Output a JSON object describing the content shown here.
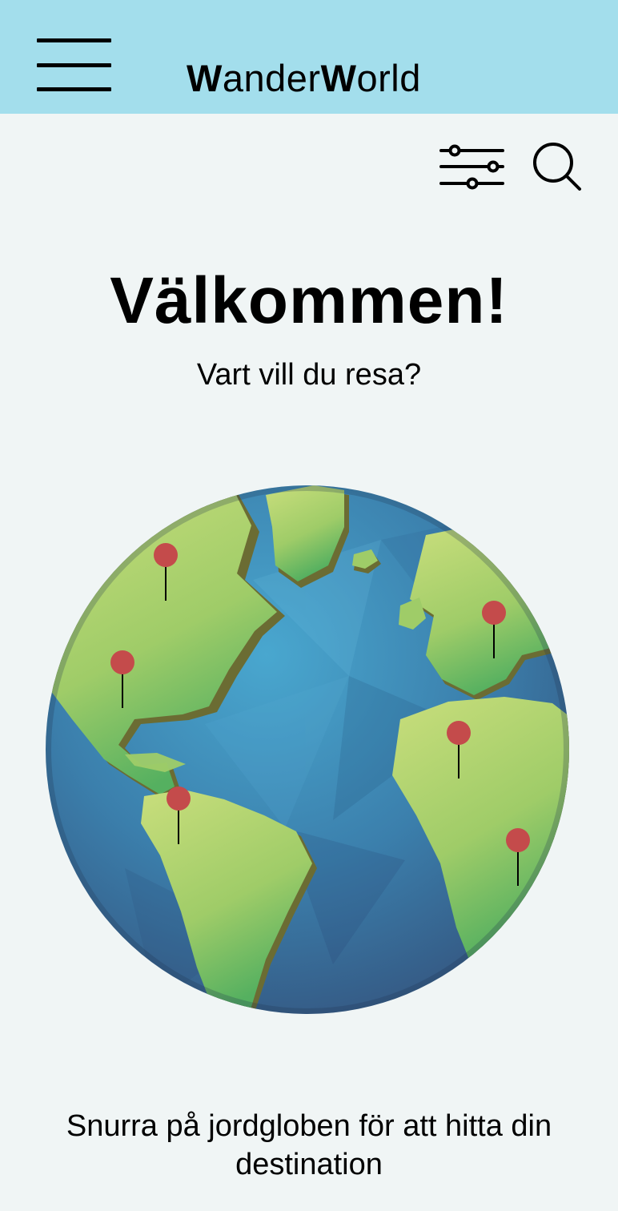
{
  "header": {
    "logo_part1_bold": "W",
    "logo_part1_rest": "ander",
    "logo_part2_bold": "W",
    "logo_part2_rest": "orld",
    "menu_icon": "hamburger-icon",
    "background_color": "#a3deec"
  },
  "toolbar": {
    "filter_icon": "filter-sliders-icon",
    "search_icon": "search-icon"
  },
  "welcome": {
    "title": "Välkommen!",
    "subtitle": "Vart vill du resa?"
  },
  "globe": {
    "pin_color": "#c44b4b",
    "ocean_color": "#3d86b2",
    "land_color": "#9cc767",
    "pins": [
      "north-america-north",
      "north-america-south",
      "south-america",
      "europe",
      "africa-west",
      "africa-east"
    ]
  },
  "hint": {
    "text": "Snurra på jordgloben för att hitta din destination"
  }
}
